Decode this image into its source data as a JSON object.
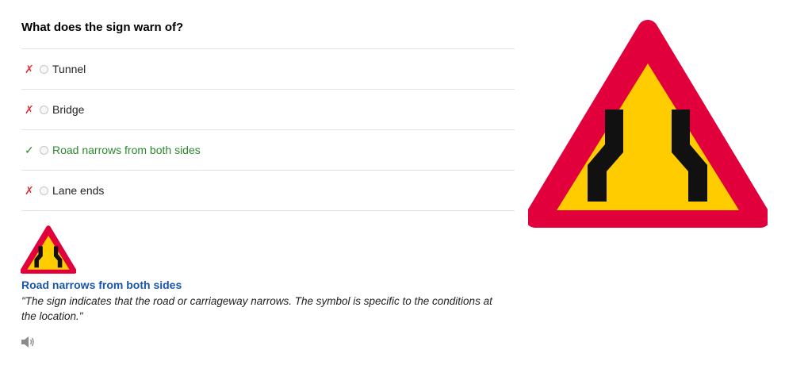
{
  "question": {
    "title": "What does the sign warn of?"
  },
  "options": [
    {
      "label": "Tunnel",
      "status": "wrong",
      "mark": "✗"
    },
    {
      "label": "Bridge",
      "status": "wrong",
      "mark": "✗"
    },
    {
      "label": "Road narrows from both sides",
      "status": "correct",
      "mark": "✓"
    },
    {
      "label": "Lane ends",
      "status": "wrong",
      "mark": "✗"
    }
  ],
  "answer": {
    "title": "Road narrows from both sides",
    "text": "\"The sign indicates that the road or carriageway narrows. The symbol is specific to the conditions at the location.\""
  },
  "icons": {
    "speaker": "speaker-icon",
    "sign": "road-narrows-both-sides-sign"
  },
  "colors": {
    "sign_red": "#e2003c",
    "sign_yellow": "#ffcc00",
    "sign_symbol": "#111111",
    "correct": "#2c8a2c",
    "wrong": "#e0323b",
    "answer_title": "#1a56a8"
  }
}
